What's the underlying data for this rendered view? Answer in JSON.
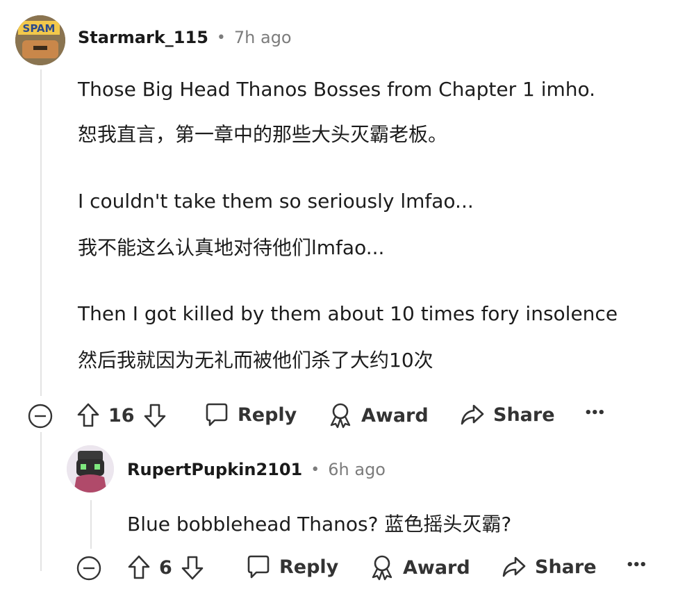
{
  "comments": [
    {
      "username": "Starmark_115",
      "separator": "•",
      "time": "7h ago",
      "avatar_text": "SPAM",
      "lines": [
        "Those Big Head Thanos Bosses from Chapter 1 imho.",
        "恕我直言，第一章中的那些大头灭霸老板。",
        "I couldn't take them so seriously lmfao...",
        "我不能这么认真地对待他们lmfao...",
        "Then I got killed by them about 10 times fory insolence",
        "然后我就因为无礼而被他们杀了大约10次"
      ],
      "votes": "16",
      "reply_label": "Reply",
      "award_label": "Award",
      "share_label": "Share",
      "more_label": "•••"
    },
    {
      "username": "RupertPupkin2101",
      "separator": "•",
      "time": "6h ago",
      "lines": [
        "Blue bobblehead Thanos?  蓝色摇头灭霸?"
      ],
      "votes": "6",
      "reply_label": "Reply",
      "award_label": "Award",
      "share_label": "Share",
      "more_label": "•••"
    }
  ],
  "colors": {
    "text": "#1c1c1c",
    "meta": "#7c7c7c",
    "thread_line": "#e3e3e3"
  }
}
